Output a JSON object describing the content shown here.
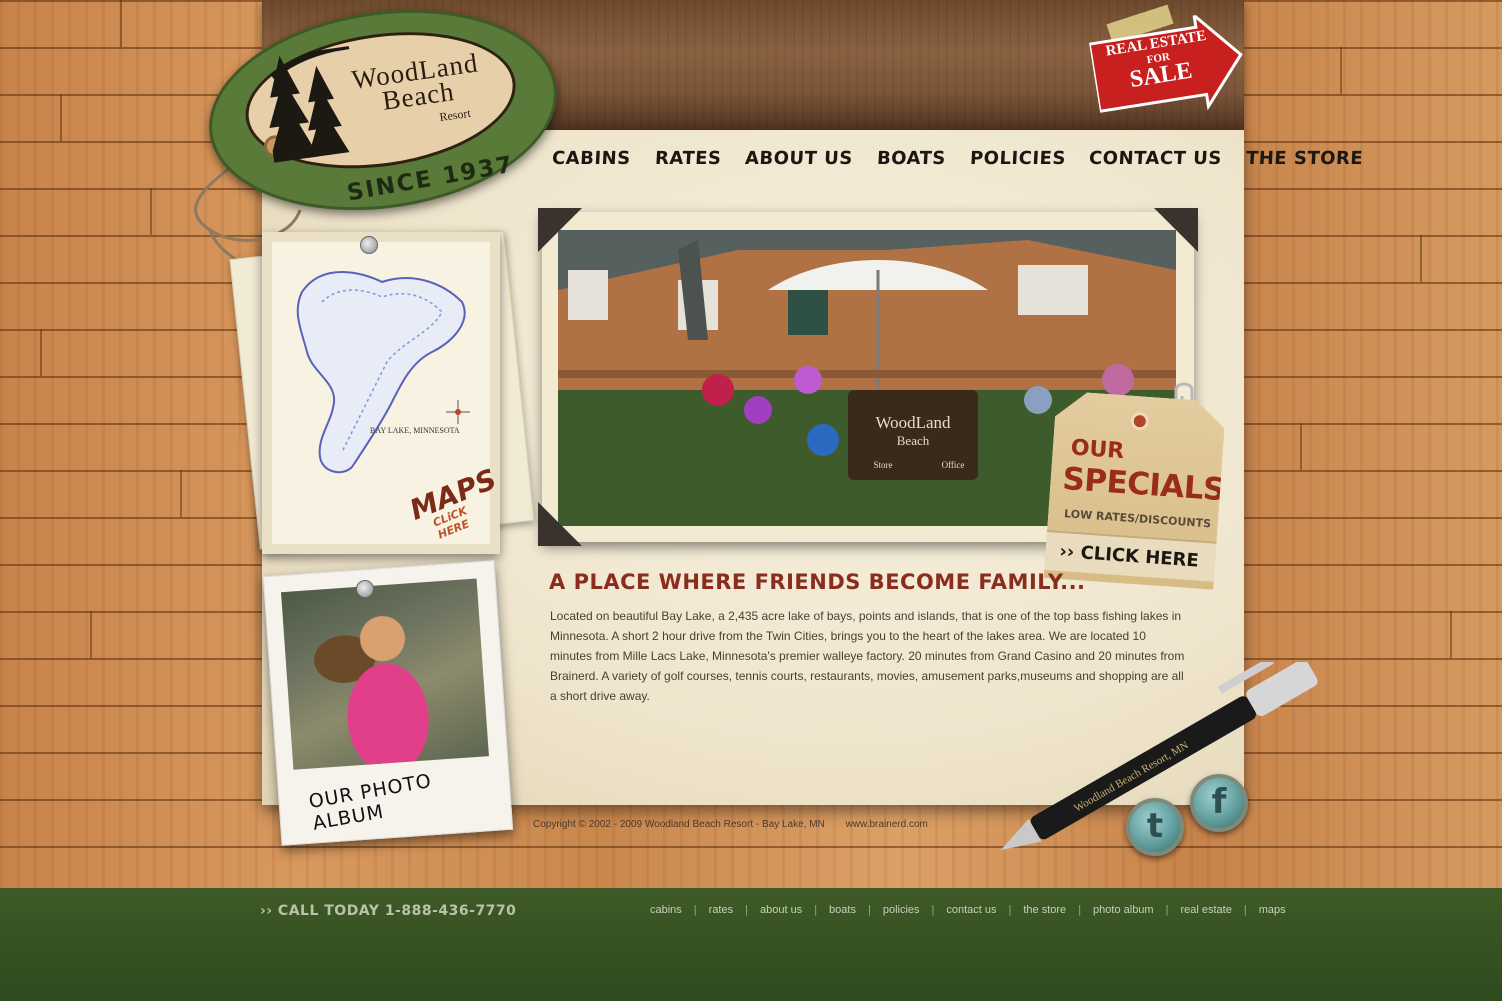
{
  "logo": {
    "line1": "WoodLand",
    "line2": "Beach",
    "resort": "Resort",
    "since": "SINCE 1937"
  },
  "real_estate": {
    "line1": "REAL ESTATE",
    "line2": "FOR",
    "line3": "SALE"
  },
  "nav": {
    "items": [
      "CaBiNS",
      "RATES",
      "ABOUT US",
      "BOATS",
      "POLiCiES",
      "CONTACT US",
      "THE STORE"
    ]
  },
  "map_card": {
    "caption": "BAY LAKE, MINNESOTA",
    "title": "MAPS",
    "action": "CLiCK HERE"
  },
  "photo_album": {
    "label": "OUR PHOTO ALBUM"
  },
  "hero_photo": {
    "sign_line1": "WoodLand",
    "sign_line2": "Beach",
    "sign_store": "Store",
    "sign_office": "Office"
  },
  "specials": {
    "our": "OUR",
    "title": "SPECIALS",
    "subtitle": "LOW RATES/DISCOUNTS",
    "action": "›› CLICK HERE"
  },
  "content": {
    "headline": "A PLACE WHERE FRiENDS BECOME FAMiLY...",
    "body": "Located on beautiful Bay Lake, a 2,435 acre lake of bays, points and islands, that is one of the top bass fishing lakes in Minnesota. A short 2 hour drive from the Twin Cities, brings you to the heart of the lakes area. We are located 10 minutes from Mille Lacs Lake, Minnesota's premier walleye factory. 20 minutes from Grand Casino and 20 minutes from Brainerd. A variety of golf courses, tennis courts, restaurants, movies, amusement parks,museums and shopping are all a short drive away."
  },
  "copyright": {
    "text": "Copyright © 2002 - 2009 Woodland Beach Resort - Bay Lake, MN",
    "site": "www.brainerd.com"
  },
  "pen": {
    "engraving": "Woodland Beach Resort, MN"
  },
  "social": {
    "twitter_icon": "twitter-icon",
    "twitter_glyph": "t",
    "facebook_icon": "facebook-icon",
    "facebook_glyph": "f"
  },
  "footer": {
    "call": "›› CALL TODAY 1-888-436-7770",
    "links": [
      "cabins",
      "rates",
      "about us",
      "boats",
      "policies",
      "contact us",
      "the store",
      "photo album",
      "real estate",
      "maps"
    ]
  },
  "colors": {
    "accent_red": "#8a2d1c",
    "logo_green": "#5a7a3a",
    "footer_green": "#3e5a26"
  }
}
